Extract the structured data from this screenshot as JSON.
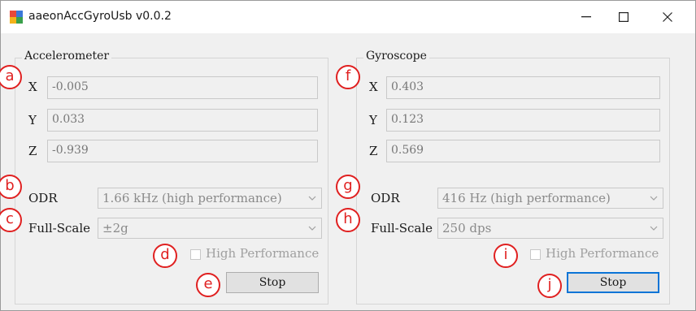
{
  "window": {
    "title": "aaeonAccGyroUsb v0.0.2",
    "controls": {
      "minimize": "minimize-icon",
      "maximize": "maximize-icon",
      "close": "close-icon"
    }
  },
  "accelerometer": {
    "title": "Accelerometer",
    "x_label": "X",
    "x_value": "-0.005",
    "y_label": "Y",
    "y_value": "0.033",
    "z_label": "Z",
    "z_value": "-0.939",
    "odr_label": "ODR",
    "odr_value": "1.66 kHz (high performance)",
    "fullscale_label": "Full-Scale",
    "fullscale_value": "±2g",
    "high_perf_label": "High Performance",
    "high_perf_checked": false,
    "stop_label": "Stop"
  },
  "gyroscope": {
    "title": "Gyroscope",
    "x_label": "X",
    "x_value": "0.403",
    "y_label": "Y",
    "y_value": "0.123",
    "z_label": "Z",
    "z_value": "0.569",
    "odr_label": "ODR",
    "odr_value": "416 Hz (high performance)",
    "fullscale_label": "Full-Scale",
    "fullscale_value": "250 dps",
    "high_perf_label": "High Performance",
    "high_perf_checked": false,
    "stop_label": "Stop"
  },
  "annotations": {
    "a": "a",
    "b": "b",
    "c": "c",
    "d": "d",
    "e": "e",
    "f": "f",
    "g": "g",
    "h": "h",
    "i": "i",
    "j": "j",
    "color": "#e02020"
  },
  "colors": {
    "focus_border": "#0a74d6",
    "window_bg": "#f0f0f0"
  }
}
